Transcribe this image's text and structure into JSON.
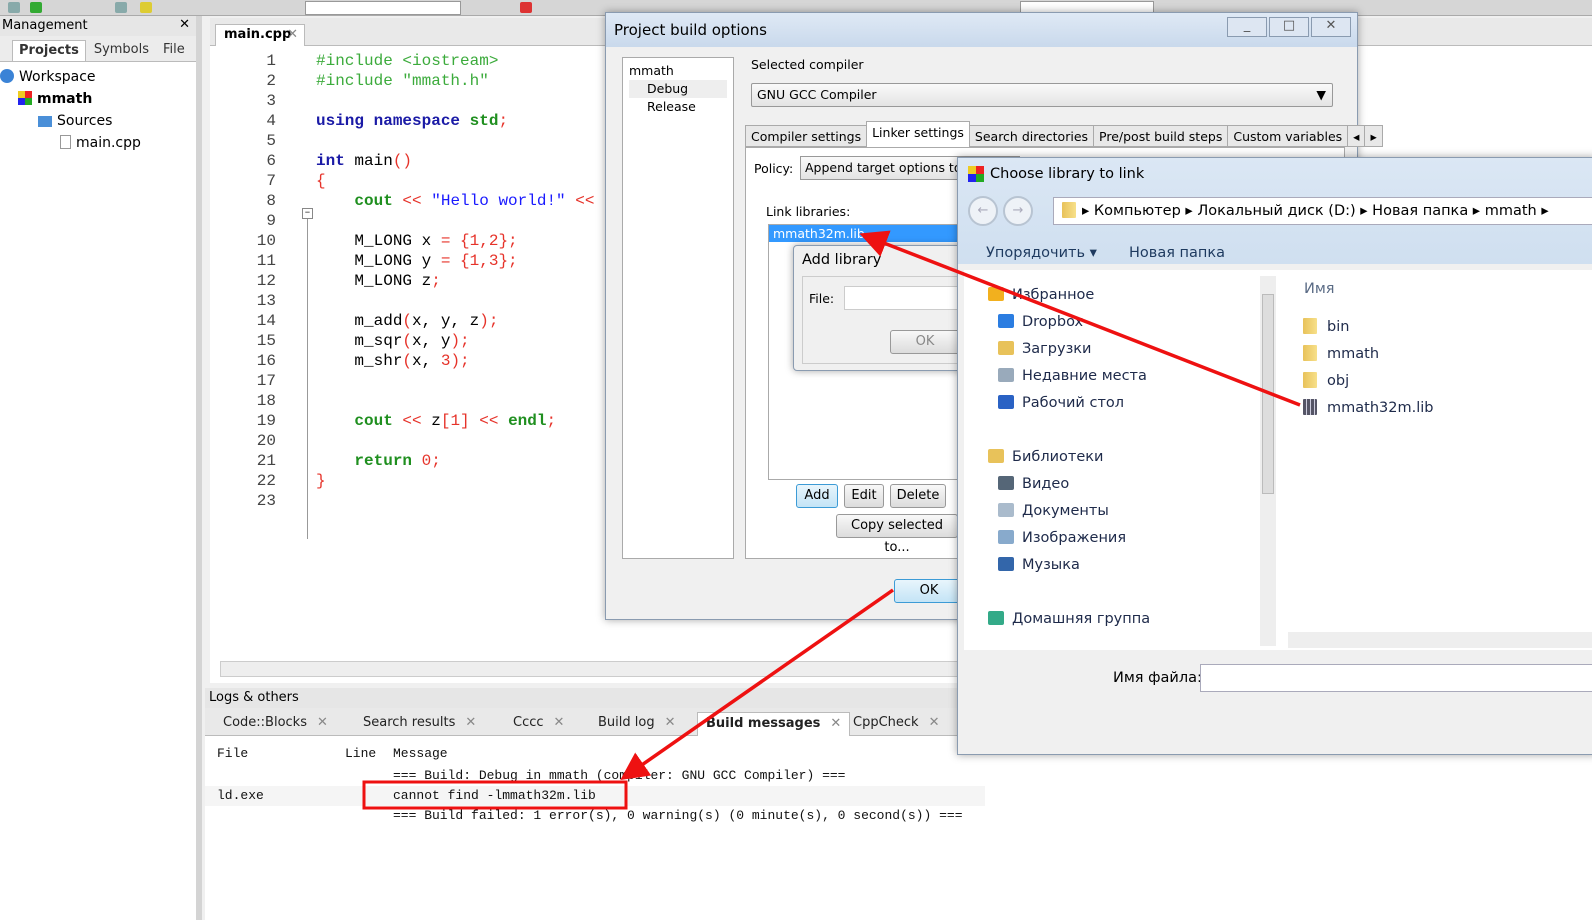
{
  "management": {
    "title": "Management",
    "tabs": [
      "Projects",
      "Symbols",
      "File"
    ],
    "tree": {
      "workspace": "Workspace",
      "project": "mmath",
      "folder": "Sources",
      "file": "main.cpp"
    }
  },
  "editor": {
    "tab": "main.cpp",
    "lines": [
      [
        {
          "t": "#include <iostream>",
          "c": "preproc"
        }
      ],
      [
        {
          "t": "#include \"mmath.h\"",
          "c": "preproc"
        }
      ],
      [],
      [
        {
          "t": "using namespace ",
          "c": "kw"
        },
        {
          "t": "std",
          "c": "kw2"
        },
        {
          "t": ";",
          "c": "op"
        }
      ],
      [],
      [
        {
          "t": "int ",
          "c": "kw"
        },
        {
          "t": "main",
          "c": "plain"
        },
        {
          "t": "()",
          "c": "op"
        }
      ],
      [
        {
          "t": "{",
          "c": "op"
        }
      ],
      [
        {
          "t": "    cout ",
          "c": "kw2"
        },
        {
          "t": "<< ",
          "c": "op"
        },
        {
          "t": "\"Hello world!\" ",
          "c": "str"
        },
        {
          "t": "<< endl;",
          "c": "op"
        }
      ],
      [],
      [
        {
          "t": "    M_LONG x ",
          "c": "plain"
        },
        {
          "t": "= {1,2};",
          "c": "op"
        }
      ],
      [
        {
          "t": "    M_LONG y ",
          "c": "plain"
        },
        {
          "t": "= {1,3};",
          "c": "op"
        }
      ],
      [
        {
          "t": "    M_LONG z",
          "c": "plain"
        },
        {
          "t": ";",
          "c": "op"
        }
      ],
      [],
      [
        {
          "t": "    m_add",
          "c": "plain"
        },
        {
          "t": "(",
          "c": "op"
        },
        {
          "t": "x, y, z",
          "c": "plain"
        },
        {
          "t": ");",
          "c": "op"
        }
      ],
      [
        {
          "t": "    m_sqr",
          "c": "plain"
        },
        {
          "t": "(",
          "c": "op"
        },
        {
          "t": "x, y",
          "c": "plain"
        },
        {
          "t": ");",
          "c": "op"
        }
      ],
      [
        {
          "t": "    m_shr",
          "c": "plain"
        },
        {
          "t": "(",
          "c": "op"
        },
        {
          "t": "x, ",
          "c": "plain"
        },
        {
          "t": "3",
          "c": "num"
        },
        {
          "t": ");",
          "c": "op"
        }
      ],
      [],
      [],
      [
        {
          "t": "    cout ",
          "c": "kw2"
        },
        {
          "t": "<< ",
          "c": "op"
        },
        {
          "t": "z",
          "c": "plain"
        },
        {
          "t": "[1] ",
          "c": "num"
        },
        {
          "t": "<< ",
          "c": "op"
        },
        {
          "t": "endl",
          "c": "kw2"
        },
        {
          "t": ";",
          "c": "op"
        }
      ],
      [],
      [
        {
          "t": "    return ",
          "c": "kw2"
        },
        {
          "t": "0;",
          "c": "num"
        }
      ],
      [
        {
          "t": "}",
          "c": "op"
        }
      ],
      []
    ]
  },
  "logs": {
    "title": "Logs & others",
    "tabs": [
      "Code::Blocks",
      "Search results",
      "Cccc",
      "Build log",
      "Build messages",
      "CppCheck"
    ],
    "active_tab": "Build messages",
    "columns": [
      "File",
      "Line",
      "Message"
    ],
    "rows": [
      {
        "file": "",
        "line": "",
        "message": "=== Build: Debug in mmath (compiler: GNU GCC Compiler) ==="
      },
      {
        "file": "ld.exe",
        "line": "",
        "message": "cannot find -lmmath32m.lib"
      },
      {
        "file": "",
        "line": "",
        "message": "=== Build failed: 1 error(s), 0 warning(s) (0 minute(s), 0 second(s)) ==="
      }
    ]
  },
  "build_options": {
    "title": "Project build options",
    "targets": [
      "mmath",
      "Debug",
      "Release"
    ],
    "selected_compiler_label": "Selected compiler",
    "compiler": "GNU GCC Compiler",
    "tabs": [
      "Compiler settings",
      "Linker settings",
      "Search directories",
      "Pre/post build steps",
      "Custom variables"
    ],
    "active_tab": "Linker settings",
    "policy_label": "Policy:",
    "policy": "Append target options to p",
    "link_libraries_label": "Link libraries:",
    "libraries": [
      "mmath32m.lib"
    ],
    "buttons": {
      "add": "Add",
      "edit": "Edit",
      "delete": "Delete",
      "copy": "Copy selected to...",
      "ok": "OK"
    }
  },
  "add_library": {
    "title": "Add library",
    "file_label": "File:",
    "file_value": "",
    "ok": "OK"
  },
  "choose_library": {
    "title": "Choose library to link",
    "breadcrumb": [
      "Компьютер",
      "Локальный диск (D:)",
      "Новая папка",
      "mmath"
    ],
    "organize": "Упорядочить",
    "new_folder": "Новая папка",
    "nav": [
      {
        "label": "Избранное",
        "icon": "star-icon",
        "group": true
      },
      {
        "label": "Dropbox",
        "icon": "dropbox-icon"
      },
      {
        "label": "Загрузки",
        "icon": "downloads-icon"
      },
      {
        "label": "Недавние места",
        "icon": "recent-places-icon"
      },
      {
        "label": "Рабочий стол",
        "icon": "desktop-icon"
      },
      {
        "label": "Библиотеки",
        "icon": "libraries-icon",
        "group": true
      },
      {
        "label": "Видео",
        "icon": "video-icon"
      },
      {
        "label": "Документы",
        "icon": "documents-icon"
      },
      {
        "label": "Изображения",
        "icon": "images-icon"
      },
      {
        "label": "Музыка",
        "icon": "music-icon"
      },
      {
        "label": "Домашняя группа",
        "icon": "homegroup-icon",
        "group": true
      }
    ],
    "column_name": "Имя",
    "files": [
      {
        "name": "bin",
        "type": "folder"
      },
      {
        "name": "mmath",
        "type": "folder"
      },
      {
        "name": "obj",
        "type": "folder"
      },
      {
        "name": "mmath32m.lib",
        "type": "library"
      }
    ],
    "filename_label": "Имя файла:",
    "filename_value": ""
  },
  "colors": {
    "annotation": "#ee1111",
    "selection": "#3399ff"
  }
}
